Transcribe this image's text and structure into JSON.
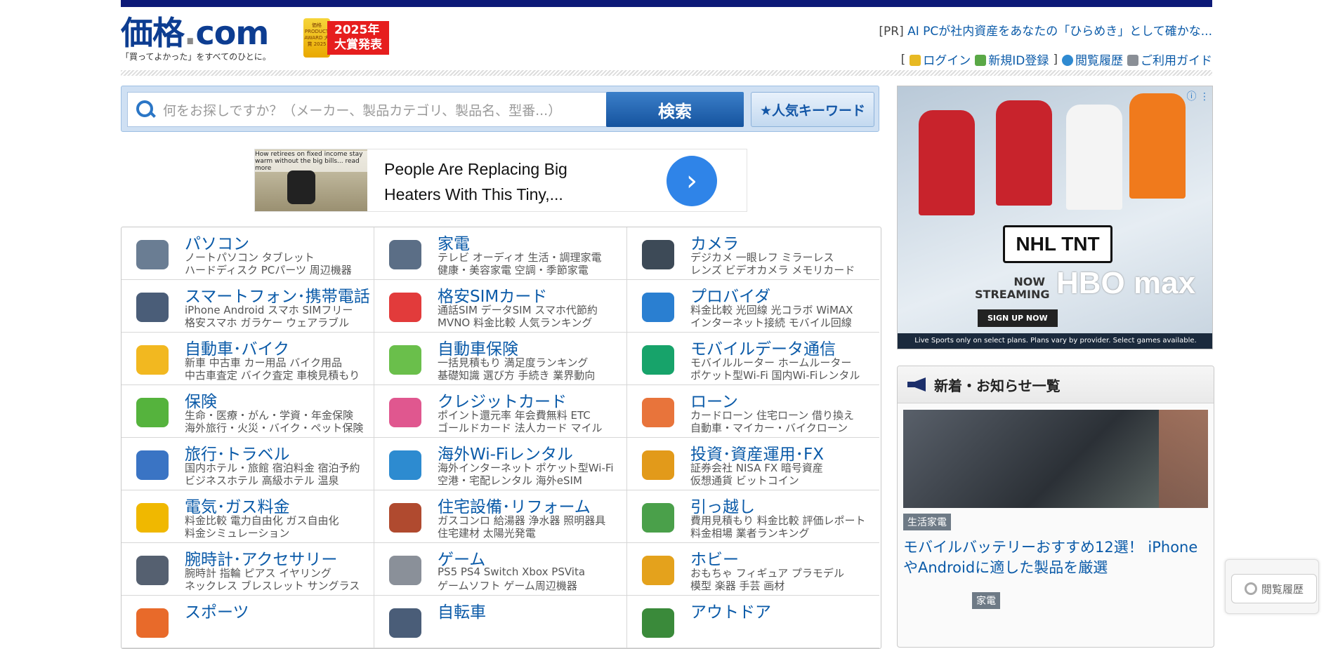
{
  "header": {
    "logo_text": "価格",
    "logo_dot": ".",
    "logo_com": "com",
    "tagline": "「買ってよかった」をすべてのひとに。",
    "award_badge": "価格 PRODUCT AWARD 大賞 2025",
    "award_banner_line1": "2025年",
    "award_banner_line2": "大賞発表",
    "pr_prefix": "[PR]",
    "pr_link": "AI PCが社内資産をあなたの「ひらめき」として確かな...",
    "links": {
      "bracket_open": "[",
      "login": "ログイン",
      "register": "新規ID登録",
      "bracket_close": "]",
      "history": "閲覧履歴",
      "guide": "ご利用ガイド"
    }
  },
  "search": {
    "placeholder": "何をお探しですか？（メーカー、製品カテゴリ、製品名、型番...）",
    "button": "検索",
    "keyword_button": "★人気キーワード"
  },
  "ad_top": {
    "caption": "How retirees on fixed income stay warm without the big bills... read more",
    "text": "People Are Replacing Big Heaters With This Tiny,...",
    "arrow": "›"
  },
  "categories": [
    {
      "title": "パソコン",
      "line1": "ノートパソコン タブレット",
      "line2": "ハードディスク PCパーツ 周辺機器",
      "icon": "laptop-icon",
      "color": "#6a7d93"
    },
    {
      "title": "家電",
      "line1": "テレビ オーディオ 生活・調理家電",
      "line2": "健康・美容家電 空調・季節家電",
      "icon": "appliance-icon",
      "color": "#5b6e86"
    },
    {
      "title": "カメラ",
      "line1": "デジカメ 一眼レフ ミラーレス",
      "line2": "レンズ ビデオカメラ メモリカード",
      "icon": "camera-icon",
      "color": "#3d4a57"
    },
    {
      "title": "スマートフォン･携帯電話",
      "line1": "iPhone Android スマホ SIMフリー",
      "line2": "格安スマホ ガラケー ウェアラブル",
      "icon": "smartphone-icon",
      "color": "#4a5d78"
    },
    {
      "title": "格安SIMカード",
      "line1": "通話SIM データSIM スマホ代節約",
      "line2": "MVNO 料金比較 人気ランキング",
      "icon": "sim-card-icon",
      "color": "#e23b3b"
    },
    {
      "title": "プロバイダ",
      "line1": "料金比較 光回線 光コラボ WiMAX",
      "line2": "インターネット接続 モバイル回線",
      "icon": "globe-icon",
      "color": "#2a7fd1"
    },
    {
      "title": "自動車･バイク",
      "line1": "新車 中古車 カー用品 バイク用品",
      "line2": "中古車査定 バイク査定 車検見積もり",
      "icon": "car-icon",
      "color": "#f2b820"
    },
    {
      "title": "自動車保険",
      "line1": "一括見積もり 満足度ランキング",
      "line2": "基礎知識 選び方 手続き 業界動向",
      "icon": "car-insurance-icon",
      "color": "#6abf4b"
    },
    {
      "title": "モバイルデータ通信",
      "line1": "モバイルルーター ホームルーター",
      "line2": "ポケット型Wi-Fi 国内Wi-Fiレンタル",
      "icon": "wifi-icon",
      "color": "#17a36a"
    },
    {
      "title": "保険",
      "line1": "生命・医療・がん・学資・年金保険",
      "line2": "海外旅行・火災・バイク・ペット保険",
      "icon": "clover-icon",
      "color": "#55b33d"
    },
    {
      "title": "クレジットカード",
      "line1": "ポイント還元率 年会費無料 ETC",
      "line2": "ゴールドカード 法人カード マイル",
      "icon": "credit-card-icon",
      "color": "#e0578f"
    },
    {
      "title": "ローン",
      "line1": "カードローン 住宅ローン 借り換え",
      "line2": "自動車・マイカー・バイクローン",
      "icon": "calculator-icon",
      "color": "#e8743b"
    },
    {
      "title": "旅行･トラベル",
      "line1": "国内ホテル・旅館 宿泊料金 宿泊予約",
      "line2": "ビジネスホテル 高級ホテル 温泉",
      "icon": "airplane-icon",
      "color": "#3a74c4"
    },
    {
      "title": "海外Wi-Fiレンタル",
      "line1": "海外インターネット ポケット型Wi-Fi",
      "line2": "空港・宅配レンタル 海外eSIM",
      "icon": "wifi-airplane-icon",
      "color": "#2d8bd0"
    },
    {
      "title": "投資･資産運用･FX",
      "line1": "証券会社 NISA FX 暗号資産",
      "line2": "仮想通貨 ビットコイン",
      "icon": "investment-icon",
      "color": "#e29a1a"
    },
    {
      "title": "電気･ガス料金",
      "line1": "料金比較 電力自由化 ガス自由化",
      "line2": "料金シミュレーション",
      "icon": "energy-icon",
      "color": "#f0b800"
    },
    {
      "title": "住宅設備･リフォーム",
      "line1": "ガスコンロ 給湯器 浄水器 照明器具",
      "line2": "住宅建材 太陽光発電",
      "icon": "house-icon",
      "color": "#b04a2f"
    },
    {
      "title": "引っ越し",
      "line1": "費用見積もり 料金比較 評価レポート",
      "line2": "料金相場 業者ランキング",
      "icon": "truck-icon",
      "color": "#4aa04a"
    },
    {
      "title": "腕時計･アクセサリー",
      "line1": "腕時計 指輪 ピアス イヤリング",
      "line2": "ネックレス ブレスレット サングラス",
      "icon": "watch-icon",
      "color": "#556070"
    },
    {
      "title": "ゲーム",
      "line1": "PS5 PS4 Switch Xbox PSVita",
      "line2": "ゲームソフト ゲーム周辺機器",
      "icon": "game-controller-icon",
      "color": "#8a9099"
    },
    {
      "title": "ホビー",
      "line1": "おもちゃ フィギュア プラモデル",
      "line2": "模型 楽器 手芸 画材",
      "icon": "robot-toy-icon",
      "color": "#e4a21c"
    },
    {
      "title": "スポーツ",
      "line1": "",
      "line2": "",
      "icon": "sports-icon",
      "color": "#e86a2a"
    },
    {
      "title": "自転車",
      "line1": "",
      "line2": "",
      "icon": "bicycle-icon",
      "color": "#4a5d78"
    },
    {
      "title": "アウトドア",
      "line1": "",
      "line2": "",
      "icon": "outdoor-icon",
      "color": "#3a8a3a"
    }
  ],
  "ad_right": {
    "league": "NHL TNT",
    "now_streaming": "NOW STREAMING",
    "brand": "HBO max",
    "cta": "SIGN UP NOW",
    "fine_print": "Live Sports only on select plans. Plans vary by provider. Select games available."
  },
  "news": {
    "heading": "新着・お知らせ一覧",
    "item1_tag": "生活家電",
    "item1_title": "モバイルバッテリーおすすめ12選！ iPhoneやAndroidに適した製品を厳選",
    "item2_tag": "家電"
  },
  "history_widget": {
    "label": "閲覧履歴"
  }
}
